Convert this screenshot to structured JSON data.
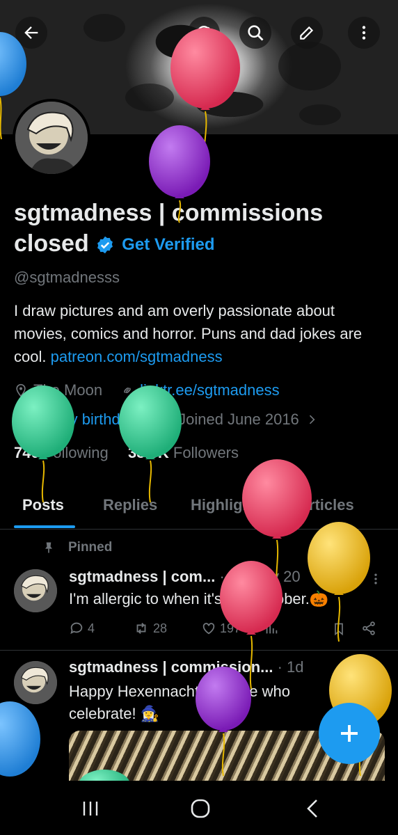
{
  "profile": {
    "name": "sgtmadness | commissions closed",
    "get_verified": "Get Verified",
    "handle": "@sgtmadnesss",
    "bio_text": "I draw pictures and am overly passionate about movies, comics and horror. Puns and dad jokes are cool. ",
    "bio_link": "patreon.com/sgtmadness",
    "location": "The Moon",
    "website": "linktr.ee/sgtmadness",
    "birthday": "Happy birthday!",
    "joined": "Joined June 2016",
    "following_count": "740",
    "following_label": "Following",
    "followers_count": "38.6K",
    "followers_label": "Followers"
  },
  "tabs": [
    "Posts",
    "Replies",
    "Highlights",
    "Articles"
  ],
  "pinned_label": "Pinned",
  "tweets": [
    {
      "author": "sgtmadness | com...",
      "meta": "· 28 May 20",
      "text": "I'm allergic to when it's not October.🎃",
      "replies": "4",
      "retweets": "28",
      "likes": "197"
    },
    {
      "author": "sgtmadness | commission...",
      "meta": "· 1d",
      "text_line1": "Happy Hexennacht to those who",
      "text_line2": "celebrate! 🧙‍♀️"
    }
  ],
  "colors": {
    "accent": "#1d9bf0",
    "muted": "#71767b",
    "balloon_red": "#e8365d",
    "balloon_purple": "#8e24c9",
    "balloon_green": "#2ecc8f",
    "balloon_yellow": "#e6b511",
    "balloon_blue": "#2e8fe0"
  },
  "icons": [
    "back-arrow-icon",
    "grok-icon",
    "search-icon",
    "edit-icon",
    "more-vertical-icon",
    "verified-badge-icon",
    "location-icon",
    "link-icon",
    "balloon-icon",
    "calendar-icon",
    "chevron-right-icon",
    "pin-icon",
    "reply-icon",
    "retweet-icon",
    "like-icon",
    "views-icon",
    "bookmark-icon",
    "share-icon",
    "compose-plus-icon",
    "recent-apps-icon",
    "home-icon",
    "nav-back-icon"
  ]
}
